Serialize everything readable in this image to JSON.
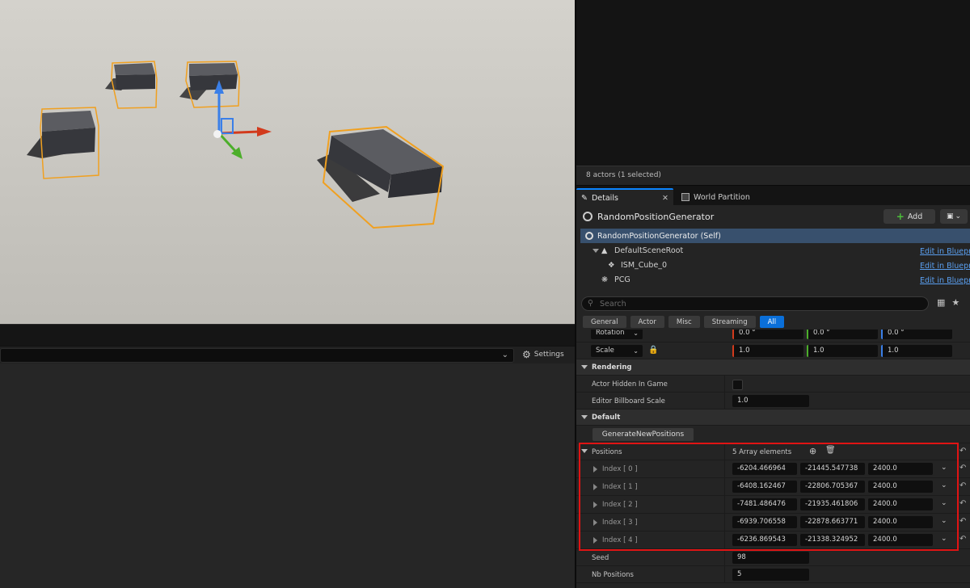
{
  "outliner": {
    "actor_count": "8 actors (1 selected)"
  },
  "tabs": [
    {
      "label": "Details",
      "active": true
    },
    {
      "label": "World Partition",
      "active": false
    }
  ],
  "settings_label": "Settings",
  "actor": {
    "name": "RandomPositionGenerator",
    "add_label": "Add"
  },
  "components": [
    {
      "label": "RandomPositionGenerator (Self)",
      "selected": true
    },
    {
      "label": "DefaultSceneRoot",
      "edit": "Edit in Blueprint"
    },
    {
      "label": "ISM_Cube_0",
      "edit": "Edit in Blueprint"
    },
    {
      "label": "PCG",
      "edit": "Edit in Blueprint"
    }
  ],
  "search": {
    "placeholder": "Search"
  },
  "categories": [
    "General",
    "Actor",
    "Misc",
    "Streaming",
    "All"
  ],
  "transform": {
    "rotation": {
      "label": "Rotation",
      "x": "0.0 °",
      "y": "0.0 °",
      "z": "0.0 °"
    },
    "scale": {
      "label": "Scale",
      "x": "1.0",
      "y": "1.0",
      "z": "1.0"
    }
  },
  "rendering": {
    "title": "Rendering",
    "hidden_label": "Actor Hidden In Game",
    "billboard_label": "Editor Billboard Scale",
    "billboard_value": "1.0"
  },
  "default": {
    "title": "Default",
    "generate_button": "GenerateNewPositions",
    "positions_label": "Positions",
    "positions_count": "5 Array elements",
    "positions": [
      {
        "index": "Index [ 0 ]",
        "x": "-6204.466964",
        "y": "-21445.547738",
        "z": "2400.0"
      },
      {
        "index": "Index [ 1 ]",
        "x": "-6408.162467",
        "y": "-22806.705367",
        "z": "2400.0"
      },
      {
        "index": "Index [ 2 ]",
        "x": "-7481.486476",
        "y": "-21935.461806",
        "z": "2400.0"
      },
      {
        "index": "Index [ 3 ]",
        "x": "-6939.706558",
        "y": "-22878.663771",
        "z": "2400.0"
      },
      {
        "index": "Index [ 4 ]",
        "x": "-6236.869543",
        "y": "-21338.324952",
        "z": "2400.0"
      }
    ],
    "seed_label": "Seed",
    "seed_value": "98",
    "nb_label": "Nb Positions",
    "nb_value": "5"
  },
  "colors": {
    "accent": "#0a6fd9",
    "selection": "#f0a020",
    "highlight": "#e01414"
  }
}
